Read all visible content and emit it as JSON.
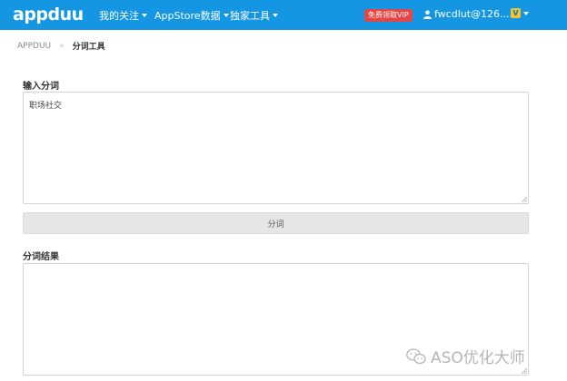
{
  "navbar": {
    "logo": "appduu",
    "menu": [
      {
        "label": "我的关注"
      },
      {
        "label": "AppStore数据"
      },
      {
        "label": "独家工具"
      }
    ],
    "vip_badge": "免费领取VIP",
    "user_label": "fwcdlut@126....",
    "v_badge": "V",
    "colors": {
      "bar": "#1596e3",
      "vip": "#e64545",
      "v_badge": "#f4c430"
    }
  },
  "breadcrumb": {
    "home": "APPDUU",
    "separator": "»",
    "current": "分词工具"
  },
  "input_section": {
    "label": "输入分词",
    "value": "职场社交"
  },
  "submit_button": {
    "label": "分词"
  },
  "result_section": {
    "label": "分词结果",
    "value": ""
  },
  "watermark": {
    "text": "ASO优化大师"
  }
}
